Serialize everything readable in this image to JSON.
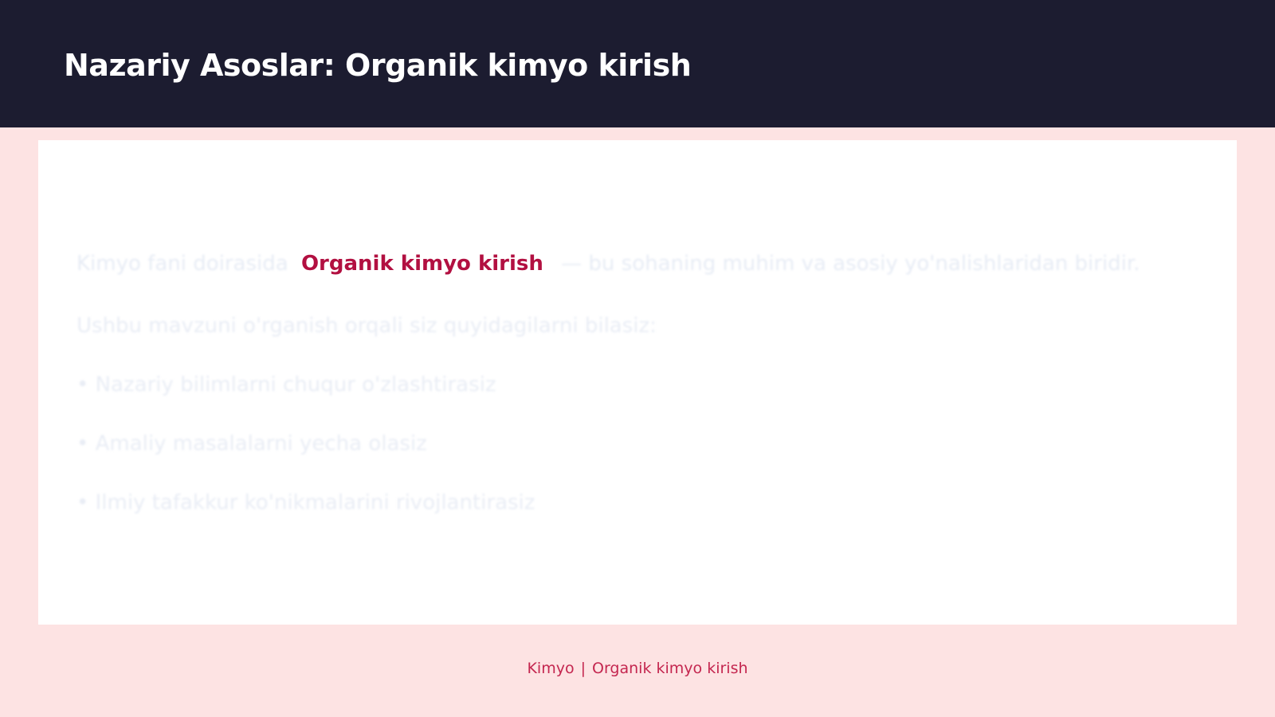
{
  "header": {
    "title": "Nazariy Asoslar: Organik kimyo kirish"
  },
  "content": {
    "intro_before": "Kimyo fani doirasida",
    "intro_keyword": "Organik kimyo kirish",
    "intro_after": "— bu sohaning muhim va asosiy yo'nalishlaridan biridir.",
    "lead": "Ushbu mavzuni o'rganish orqali siz quyidagilarni bilasiz:",
    "bullets": [
      "• Nazariy bilimlarni chuqur o'zlashtirasiz",
      "• Amaliy masalalarni yecha olasiz",
      "• Ilmiy tafakkur ko'nikmalarini rivojlantirasiz"
    ]
  },
  "footer": {
    "subject": "Kimyo",
    "separator": "|",
    "topic": "Organik kimyo kirish"
  }
}
